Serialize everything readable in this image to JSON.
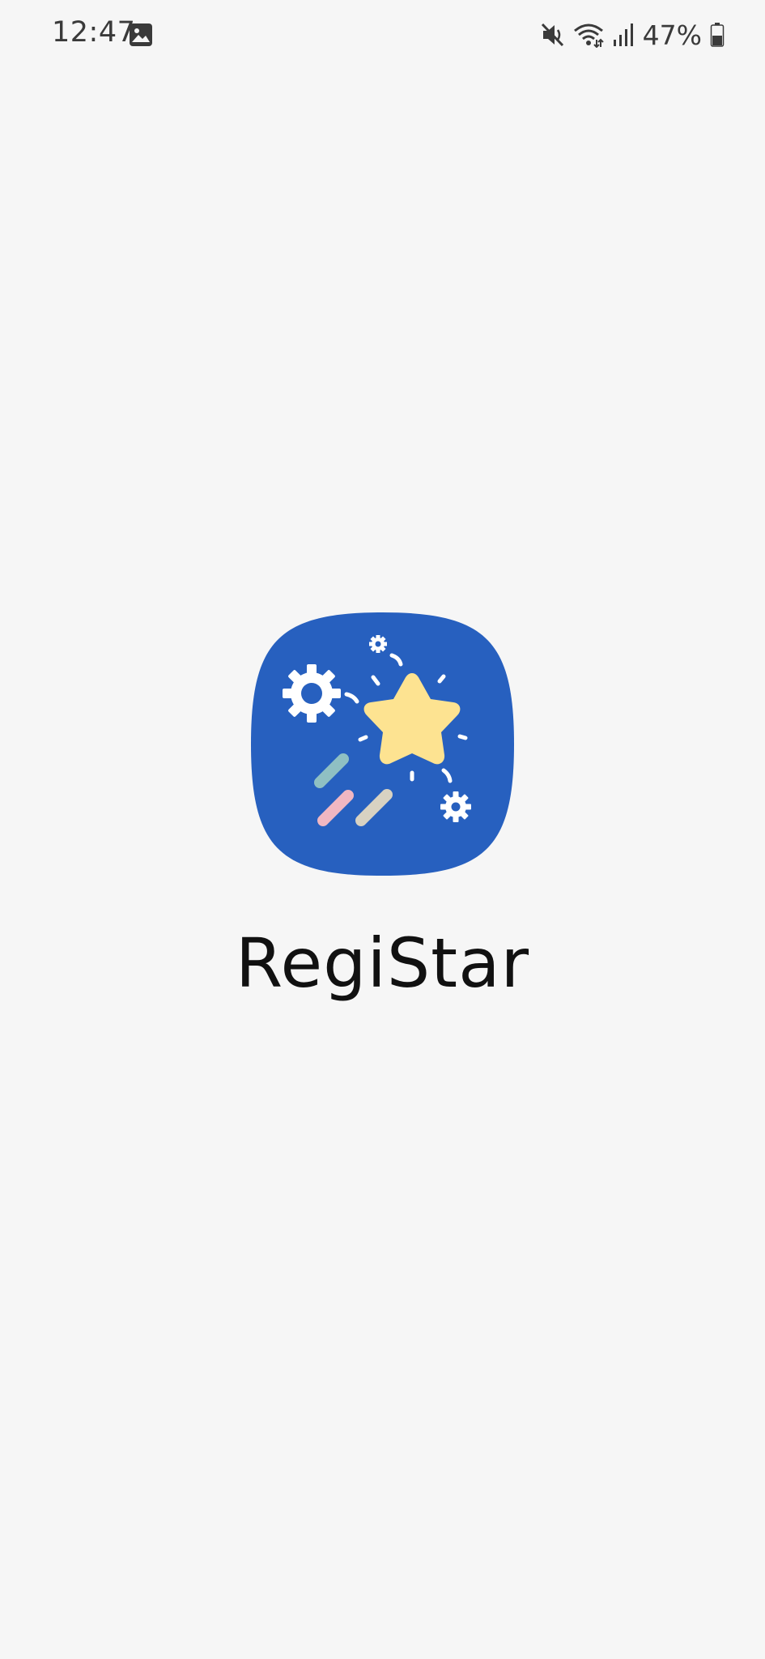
{
  "status_bar": {
    "time": "12:47",
    "battery_percent": "47%",
    "icons": [
      "gallery-icon",
      "mute-icon",
      "wifi-icon",
      "signal-icon",
      "battery-icon"
    ]
  },
  "splash": {
    "app_name": "RegiStar",
    "icon_background_color": "#2760bf",
    "star_color": "#fde391"
  }
}
